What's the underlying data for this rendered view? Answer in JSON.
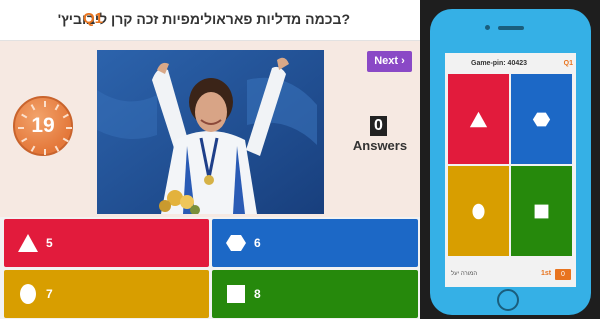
{
  "question": {
    "number": "Q1",
    "text": "?בכמה מדליות פאראולימפיות זכה קרן ליבוביץ'"
  },
  "timer": {
    "seconds": "19"
  },
  "controls": {
    "next_label": "Next ›"
  },
  "answers_panel": {
    "count": "0",
    "label": "Answers"
  },
  "answer_options": [
    {
      "shape": "triangle-icon",
      "value": "5",
      "color": "#e21b3c"
    },
    {
      "shape": "hexagon-icon",
      "value": "6",
      "color": "#1c68c6"
    },
    {
      "shape": "circle-icon",
      "value": "7",
      "color": "#d89e00"
    },
    {
      "shape": "square-icon",
      "value": "8",
      "color": "#26890c"
    }
  ],
  "phone": {
    "game_pin": "Game-pin: 40423",
    "question_number": "Q1",
    "player_name": "המורה יעל",
    "rank": "1st",
    "score": "0"
  },
  "colors": {
    "accent_orange": "#e8741f",
    "next_purple": "#8a49c6",
    "phone_blue": "#35b0e6"
  }
}
